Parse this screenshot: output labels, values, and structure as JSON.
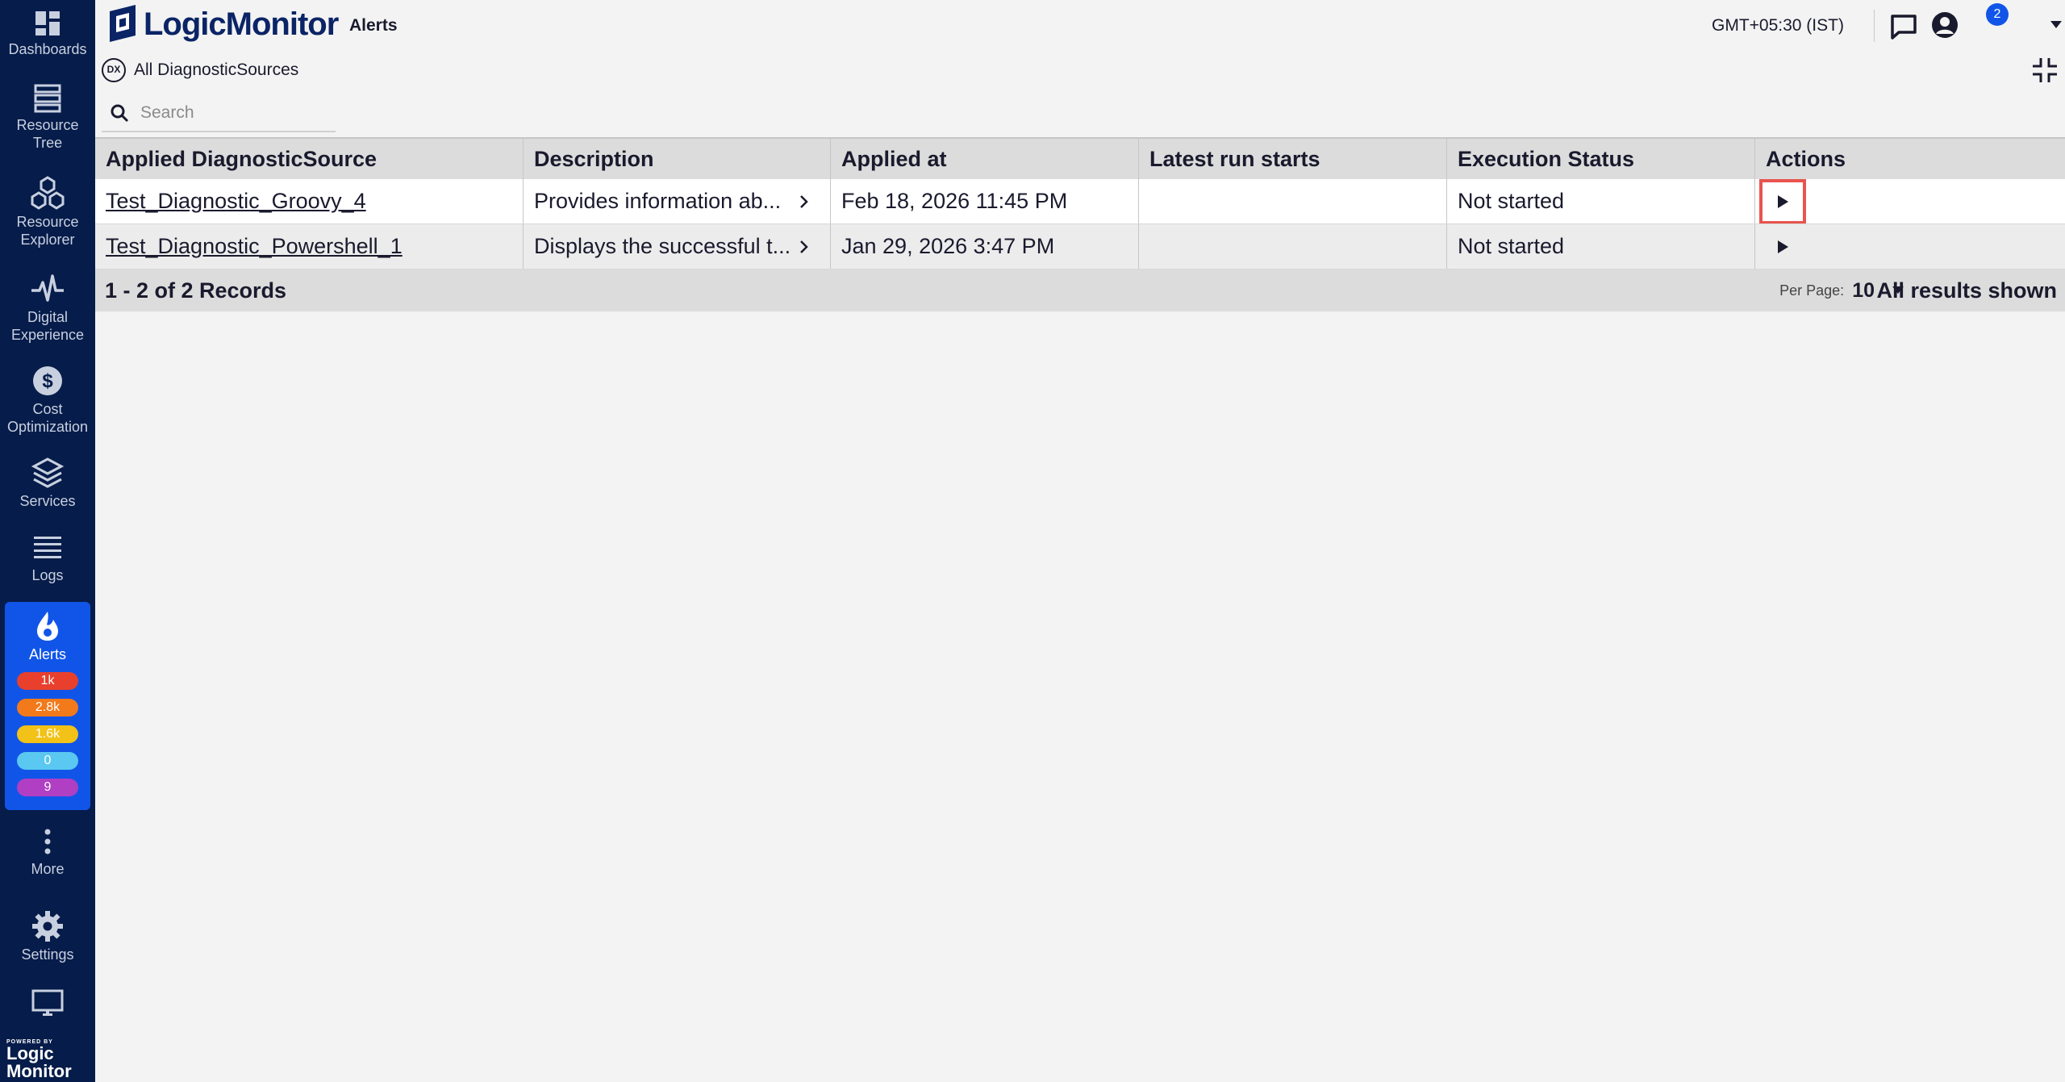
{
  "sidebar": {
    "items": [
      {
        "label": "Dashboards",
        "icon": "dashboards-icon"
      },
      {
        "label": "Resource\nTree",
        "icon": "resource-tree-icon"
      },
      {
        "label": "Resource\nExplorer",
        "icon": "resource-explorer-icon"
      },
      {
        "label": "Digital\nExperience",
        "icon": "pulse-icon"
      },
      {
        "label": "Cost\nOptimization",
        "icon": "dollar-icon"
      },
      {
        "label": "Services",
        "icon": "layers-icon"
      },
      {
        "label": "Logs",
        "icon": "logs-icon"
      },
      {
        "label": "Alerts",
        "icon": "flame-icon"
      },
      {
        "label": "More",
        "icon": "more-icon"
      },
      {
        "label": "Settings",
        "icon": "gear-icon"
      }
    ],
    "alert_badges": [
      {
        "value": "1k",
        "color": "#e8402c"
      },
      {
        "value": "2.8k",
        "color": "#f27a1a"
      },
      {
        "value": "1.6k",
        "color": "#f2c218"
      },
      {
        "value": "0",
        "color": "#5ac8f0"
      },
      {
        "value": "9",
        "color": "#b03fc4"
      }
    ],
    "powered_small": "POWERED BY",
    "powered_line1": "Logic",
    "powered_line2": "Monitor"
  },
  "header": {
    "logo_text": "LogicMonitor",
    "page_name": "Alerts",
    "timezone": "GMT+05:30 (IST)",
    "chat_badge": "2"
  },
  "breadcrumb": {
    "icon_text": "DX",
    "label": "All DiagnosticSources"
  },
  "search": {
    "placeholder": "Search"
  },
  "table": {
    "headers": [
      "Applied DiagnosticSource",
      "Description",
      "Applied at",
      "Latest run starts",
      "Execution Status",
      "Actions"
    ],
    "rows": [
      {
        "source": "Test_Diagnostic_Groovy_4",
        "description": "Provides information ab...",
        "applied_at": "Feb 18, 2026 11:45 PM",
        "latest_run": "",
        "status": "Not started"
      },
      {
        "source": "Test_Diagnostic_Powershell_1",
        "description": "Displays the successful t...",
        "applied_at": "Jan 29, 2026 3:47 PM",
        "latest_run": "",
        "status": "Not started"
      }
    ],
    "records": "1 - 2 of 2 Records",
    "per_page_label": "Per Page:",
    "per_page_value": "10",
    "all_results": "All results shown"
  },
  "colors": {
    "sidebar_bg": "#061c4a",
    "active_bg": "#1155e8",
    "focus_outline": "#e8544e"
  }
}
